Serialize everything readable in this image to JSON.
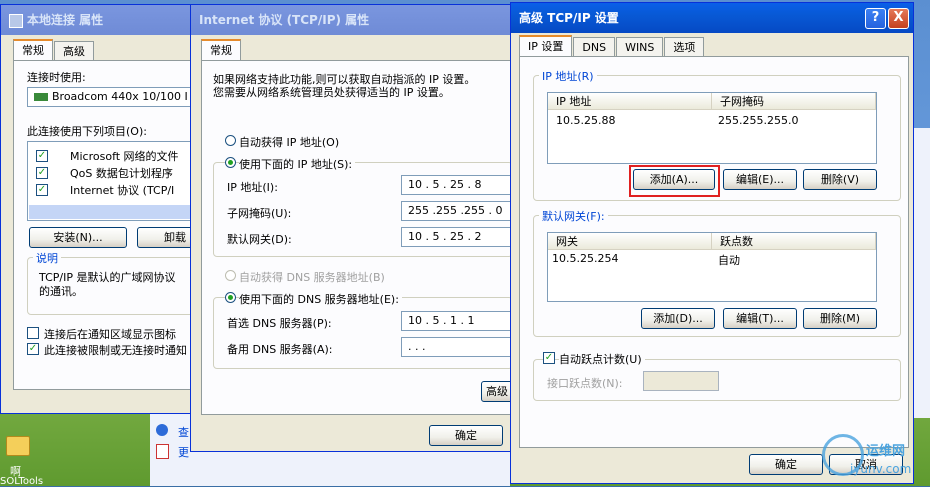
{
  "desktop": {
    "icon1_label": "啊",
    "icon2_label": "SOLTools"
  },
  "win_local": {
    "title": "本地连接 属性",
    "tabs": [
      "常规",
      "高级"
    ],
    "connect_using_label": "连接时使用:",
    "adapter_name": "Broadcom 440x 10/100 I",
    "items_label": "此连接使用下列项目(O):",
    "items": [
      "Microsoft 网络的文件",
      "QoS 数据包计划程序",
      "Internet 协议 (TCP/I"
    ],
    "install_btn": "安装(N)...",
    "uninstall_btn": "卸载",
    "desc_group": "说明",
    "desc_text_1": "TCP/IP 是默认的广域网协议",
    "desc_text_2": "的通讯。",
    "show_icon_label": "连接后在通知区域显示图标",
    "notify_label": "此连接被限制或无连接时通知",
    "taskbar_item1": "查",
    "taskbar_item2": "更"
  },
  "win_tcpip": {
    "title": "Internet 协议 (TCP/IP) 属性",
    "tab": "常规",
    "intro_1": "如果网络支持此功能,则可以获取自动指派的 IP 设置。",
    "intro_2": "您需要从网络系统管理员处获得适当的 IP 设置。",
    "auto_ip": "自动获得 IP 地址(O)",
    "manual_ip": "使用下面的 IP 地址(S):",
    "ip_label": "IP 地址(I):",
    "ip_value": "10 . 5 . 25 . 8",
    "mask_label": "子网掩码(U):",
    "mask_value": "255 .255 .255 . 0",
    "gw_label": "默认网关(D):",
    "gw_value": "10 . 5 . 25 . 2",
    "auto_dns": "自动获得 DNS 服务器地址(B)",
    "manual_dns": "使用下面的 DNS 服务器地址(E):",
    "dns1_label": "首选 DNS 服务器(P):",
    "dns1_value": "10 . 5 . 1 . 1",
    "dns2_label": "备用 DNS 服务器(A):",
    "dns2_value": " . . . ",
    "advanced_btn": "高级",
    "ok_btn": "确定"
  },
  "win_adv": {
    "title": "高级 TCP/IP 设置",
    "tabs": [
      "IP 设置",
      "DNS",
      "WINS",
      "选项"
    ],
    "ip_group": "IP 地址(R)",
    "ip_cols": [
      "IP 地址",
      "子网掩码"
    ],
    "ip_rows": [
      [
        "10.5.25.88",
        "255.255.255.0"
      ]
    ],
    "add_btn": "添加(A)...",
    "edit_btn": "编辑(E)...",
    "delete_btn": "删除(V)",
    "gw_group": "默认网关(F):",
    "gw_cols": [
      "网关",
      "跃点数"
    ],
    "gw_rows": [
      [
        "10.5.25.254",
        "自动"
      ]
    ],
    "gw_add_btn": "添加(D)...",
    "gw_edit_btn": "编辑(T)...",
    "gw_delete_btn": "删除(M)",
    "auto_metric": "自动跃点计数(U)",
    "iface_metric": "接口跃点数(N):",
    "ok_btn": "确定",
    "cancel_btn": "取消",
    "help_glyph": "?",
    "close_glyph": "X"
  },
  "watermark": {
    "line1": "运维网",
    "line2": "iyunv.com"
  }
}
